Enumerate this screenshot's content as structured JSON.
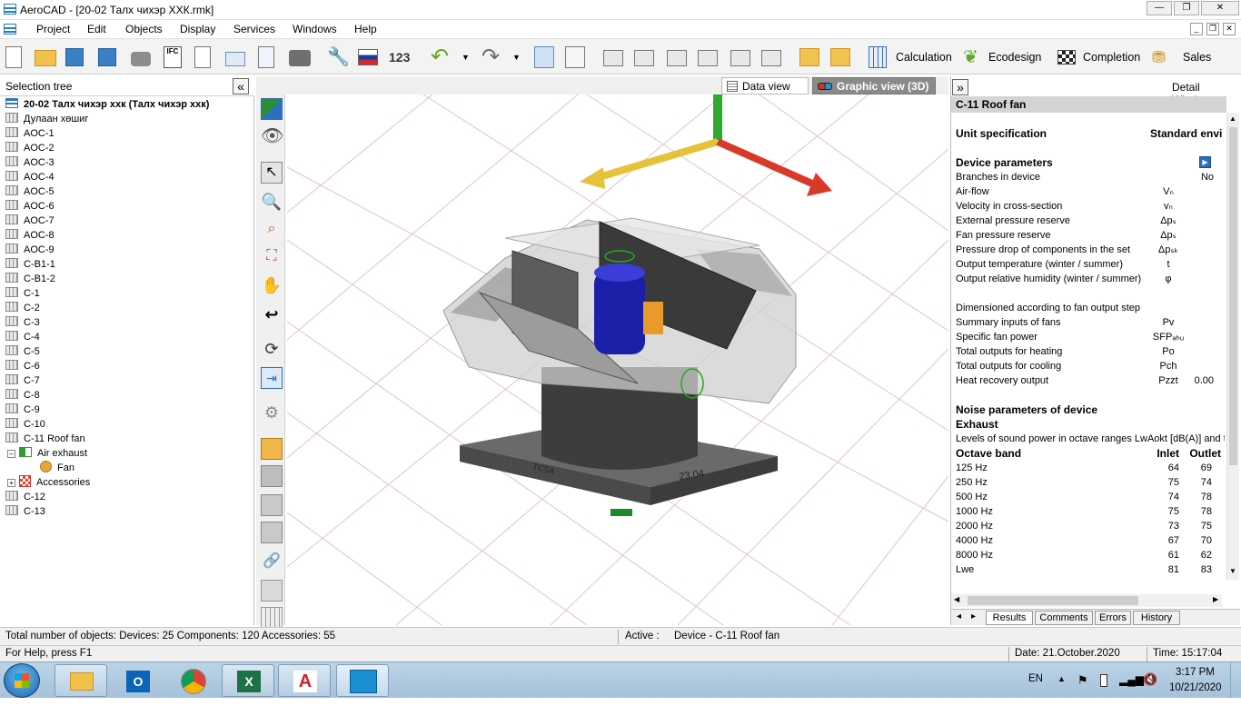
{
  "window": {
    "title": "AeroCAD - [20-02 Талх чихэр ХХК.rmk]"
  },
  "menu": [
    "Project",
    "Edit",
    "Objects",
    "Display",
    "Services",
    "Windows",
    "Help"
  ],
  "toolbar": {
    "calculation": "Calculation",
    "ecodesign": "Ecodesign",
    "completion": "Completion",
    "sales": "Sales"
  },
  "tree": {
    "header": "Selection tree",
    "collapse_btn": "«",
    "root": "20-02 Талх чихэр ххк (Талх чихэр ххк)",
    "items": [
      "Дулаан хөшиг",
      "AOC-1",
      "AOC-2",
      "AOC-3",
      "AOC-4",
      "AOC-5",
      "AOC-6",
      "AOC-7",
      "AOC-8",
      "AOC-9",
      "C-B1-1",
      "C-B1-2",
      "C-1",
      "C-2",
      "C-3",
      "C-4",
      "C-5",
      "C-6",
      "C-7",
      "C-8",
      "C-9",
      "C-10",
      "C-11 Roof fan"
    ],
    "children": {
      "air_exhaust": "Air exhaust",
      "fan": "Fan",
      "accessories": "Accessories"
    },
    "after": [
      "C-12",
      "C-13"
    ]
  },
  "tabs": {
    "data_view": "Data view",
    "graphic_view": "Graphic view (3D)"
  },
  "model": {
    "label_left": "TCSA",
    "label_right": "23.04"
  },
  "detail": {
    "header": "Detail Window",
    "expand_btn": "»",
    "title": "C-11 Roof fan",
    "unit_spec": "Unit specification",
    "unit_spec_value": "Standard envi",
    "device_params": "Device parameters",
    "params": [
      {
        "label": "Branches in device",
        "sym": "",
        "val": "No"
      },
      {
        "label": "Air-flow",
        "sym": "Vₙ",
        "val": ""
      },
      {
        "label": "Velocity in cross-section",
        "sym": "vₙ",
        "val": ""
      },
      {
        "label": "External pressure reserve",
        "sym": "Δpₛ",
        "val": ""
      },
      {
        "label": "Fan pressure reserve",
        "sym": "Δpₛ",
        "val": ""
      },
      {
        "label": "Pressure drop of components in the set",
        "sym": "Δpₛₖ",
        "val": ""
      },
      {
        "label": "Output temperature (winter / summer)",
        "sym": "t",
        "val": ""
      },
      {
        "label": "Output relative humidity (winter / summer)",
        "sym": "φ",
        "val": ""
      }
    ],
    "dimensioned": "Dimensioned according to fan output step",
    "params2": [
      {
        "label": "Summary inputs of fans",
        "sym": "Pv",
        "val": ""
      },
      {
        "label": "Specific fan power",
        "sym": "SFPₐₕᵤ",
        "val": ""
      },
      {
        "label": "Total outputs for heating",
        "sym": "Po",
        "val": ""
      },
      {
        "label": "Total outputs for cooling",
        "sym": "Pch",
        "val": ""
      },
      {
        "label": "Heat recovery output",
        "sym": "Pzzt",
        "val": "0.00"
      }
    ],
    "noise_title": "Noise parameters of device",
    "exhaust": "Exhaust",
    "levels_text": "Levels of sound power in octave ranges LwAokt [dB(A)] and total",
    "octave_header": {
      "band": "Octave band",
      "inlet": "Inlet",
      "outlet": "Outlet"
    },
    "octave": [
      {
        "band": "125 Hz",
        "inlet": "64",
        "outlet": "69"
      },
      {
        "band": "250 Hz",
        "inlet": "75",
        "outlet": "74"
      },
      {
        "band": "500 Hz",
        "inlet": "74",
        "outlet": "78"
      },
      {
        "band": "1000 Hz",
        "inlet": "75",
        "outlet": "78"
      },
      {
        "band": "2000 Hz",
        "inlet": "73",
        "outlet": "75"
      },
      {
        "band": "4000 Hz",
        "inlet": "67",
        "outlet": "70"
      },
      {
        "band": "8000 Hz",
        "inlet": "61",
        "outlet": "62"
      },
      {
        "band": "Lwe",
        "inlet": "81",
        "outlet": "83"
      }
    ],
    "bottom_tabs": [
      "Results",
      "Comments",
      "Errors",
      "History"
    ]
  },
  "status": {
    "totals": "Total number of objects: Devices: 25   Components: 120   Accessories: 55",
    "active_label": "Active :",
    "active_value": "Device - C-11 Roof fan",
    "help": "For Help, press F1",
    "date": "Date:  21.October.2020",
    "time": "Time:  15:17:04"
  },
  "taskbar": {
    "lang": "EN",
    "clock_time": "3:17 PM",
    "clock_date": "10/21/2020"
  }
}
